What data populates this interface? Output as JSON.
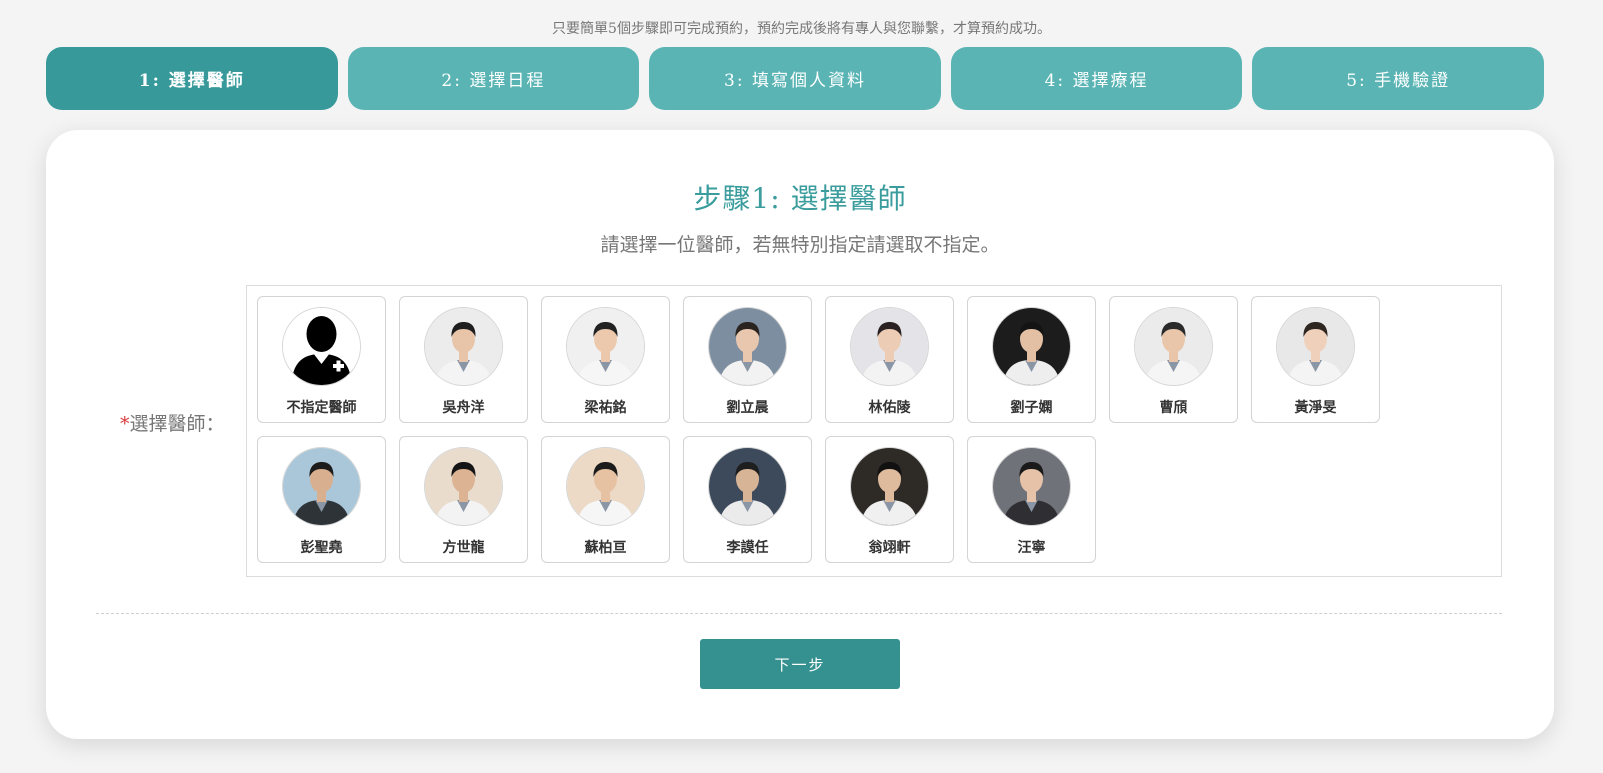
{
  "header": {
    "intro": "只要簡單5個步驟即可完成預約，預約完成後將有專人與您聯繫，才算預約成功。"
  },
  "steps": [
    {
      "label": "1: 選擇醫師"
    },
    {
      "label": "2: 選擇日程"
    },
    {
      "label": "3: 填寫個人資料"
    },
    {
      "label": "4: 選擇療程"
    },
    {
      "label": "5: 手機驗證"
    }
  ],
  "card": {
    "title": "步驟1: 選擇醫師",
    "subtitle": "請選擇一位醫師，若無特別指定請選取不指定。",
    "required_mark": "*",
    "field_label": "選擇醫師：",
    "next_label": "下一步"
  },
  "doctors": [
    {
      "name": "不指定醫師",
      "icon": "doctor-placeholder-icon",
      "bg": "#ffffff",
      "skin": "#000000",
      "hair": "#000000",
      "coat": "#000000"
    },
    {
      "name": "吳舟洋",
      "icon": "doctor-photo",
      "bg": "#ececec",
      "skin": "#e8c4a8",
      "hair": "#1e1e1e",
      "coat": "#f4f4f4"
    },
    {
      "name": "梁祐銘",
      "icon": "doctor-photo",
      "bg": "#f0f0f0",
      "skin": "#ecc9ad",
      "hair": "#222222",
      "coat": "#f6f6f6"
    },
    {
      "name": "劉立晨",
      "icon": "doctor-photo",
      "bg": "#7d8ea0",
      "skin": "#e9c7ae",
      "hair": "#2a2420",
      "coat": "#f2f2f2"
    },
    {
      "name": "林佑陵",
      "icon": "doctor-photo",
      "bg": "#e4e4e8",
      "skin": "#ecccb4",
      "hair": "#2a2222",
      "coat": "#f3f3f3"
    },
    {
      "name": "劉子嫻",
      "icon": "doctor-photo",
      "bg": "#1c1c1c",
      "skin": "#e3bfa3",
      "hair": "#141414",
      "coat": "#eeeeee"
    },
    {
      "name": "曹頎",
      "icon": "doctor-photo",
      "bg": "#ebebeb",
      "skin": "#e9c6aa",
      "hair": "#2a2a2a",
      "coat": "#f5f5f5"
    },
    {
      "name": "黃淨旻",
      "icon": "doctor-photo",
      "bg": "#e8e8e8",
      "skin": "#efd0ba",
      "hair": "#2e2620",
      "coat": "#f4f4f4"
    },
    {
      "name": "彭聖堯",
      "icon": "doctor-photo",
      "bg": "#a9c7d8",
      "skin": "#d9b08f",
      "hair": "#1c1c1c",
      "coat": "#2e3338"
    },
    {
      "name": "方世龍",
      "icon": "doctor-photo",
      "bg": "#eadccd",
      "skin": "#dcb494",
      "hair": "#151515",
      "coat": "#f3f3f3"
    },
    {
      "name": "蘇柏亘",
      "icon": "doctor-photo",
      "bg": "#ecdac6",
      "skin": "#e6c2a3",
      "hair": "#1c1c1c",
      "coat": "#f6f6f6"
    },
    {
      "name": "李謨任",
      "icon": "doctor-photo",
      "bg": "#3d4a5c",
      "skin": "#d8b496",
      "hair": "#1e1e1e",
      "coat": "#ebebeb"
    },
    {
      "name": "翁翊軒",
      "icon": "doctor-photo",
      "bg": "#2e2a26",
      "skin": "#dfbb9d",
      "hair": "#111111",
      "coat": "#f0f0f0"
    },
    {
      "name": "汪寧",
      "icon": "doctor-photo",
      "bg": "#6f7278",
      "skin": "#e6c3a8",
      "hair": "#1a1a1a",
      "coat": "#2f2f33"
    }
  ]
}
